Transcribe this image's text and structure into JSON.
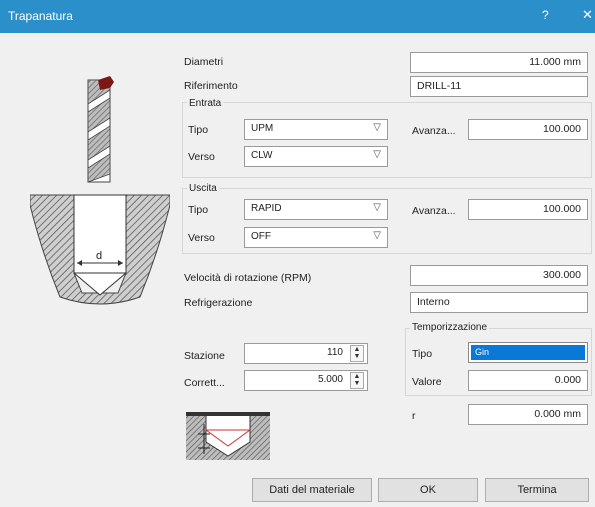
{
  "window": {
    "title": "Trapanatura",
    "help": "?",
    "close": "✕"
  },
  "diagram": {
    "d_label": "d"
  },
  "fields": {
    "diametri_label": "Diametri",
    "diametri_value": "11.000 mm",
    "riferimento_label": "Riferimento",
    "riferimento_value": "DRILL-11"
  },
  "entrata": {
    "legend": "Entrata",
    "tipo_label": "Tipo",
    "tipo_value": "UPM",
    "verso_label": "Verso",
    "verso_value": "CLW",
    "avanza_label": "Avanza...",
    "avanza_value": "100.000"
  },
  "uscita": {
    "legend": "Uscita",
    "tipo_label": "Tipo",
    "tipo_value": "RAPID",
    "verso_label": "Verso",
    "verso_value": "OFF",
    "avanza_label": "Avanza...",
    "avanza_value": "100.000"
  },
  "velocita": {
    "label": "Velocità di rotazione (RPM)",
    "value": "300.000"
  },
  "refrigerazione": {
    "label": "Refrigerazione",
    "value": "Interno"
  },
  "temporizzazione": {
    "legend": "Temporizzazione",
    "tipo_label": "Tipo",
    "tipo_value": "Gin",
    "valore_label": "Valore",
    "valore_value": "0.000"
  },
  "stazione": {
    "label": "Stazione",
    "value": "110"
  },
  "correttore": {
    "label": "Corrett...",
    "value": "5.000"
  },
  "r": {
    "label": "r",
    "value": "0.000 mm"
  },
  "buttons": {
    "material": "Dati del materiale",
    "ok": "OK",
    "termina": "Termina"
  },
  "icons": {
    "dropdown": "▽",
    "spin_up": "▲",
    "spin_down": "▼"
  },
  "colors": {
    "titlebar": "#2b8fc9",
    "selection": "#0a78d7",
    "drill_tip": "#7a1818"
  }
}
